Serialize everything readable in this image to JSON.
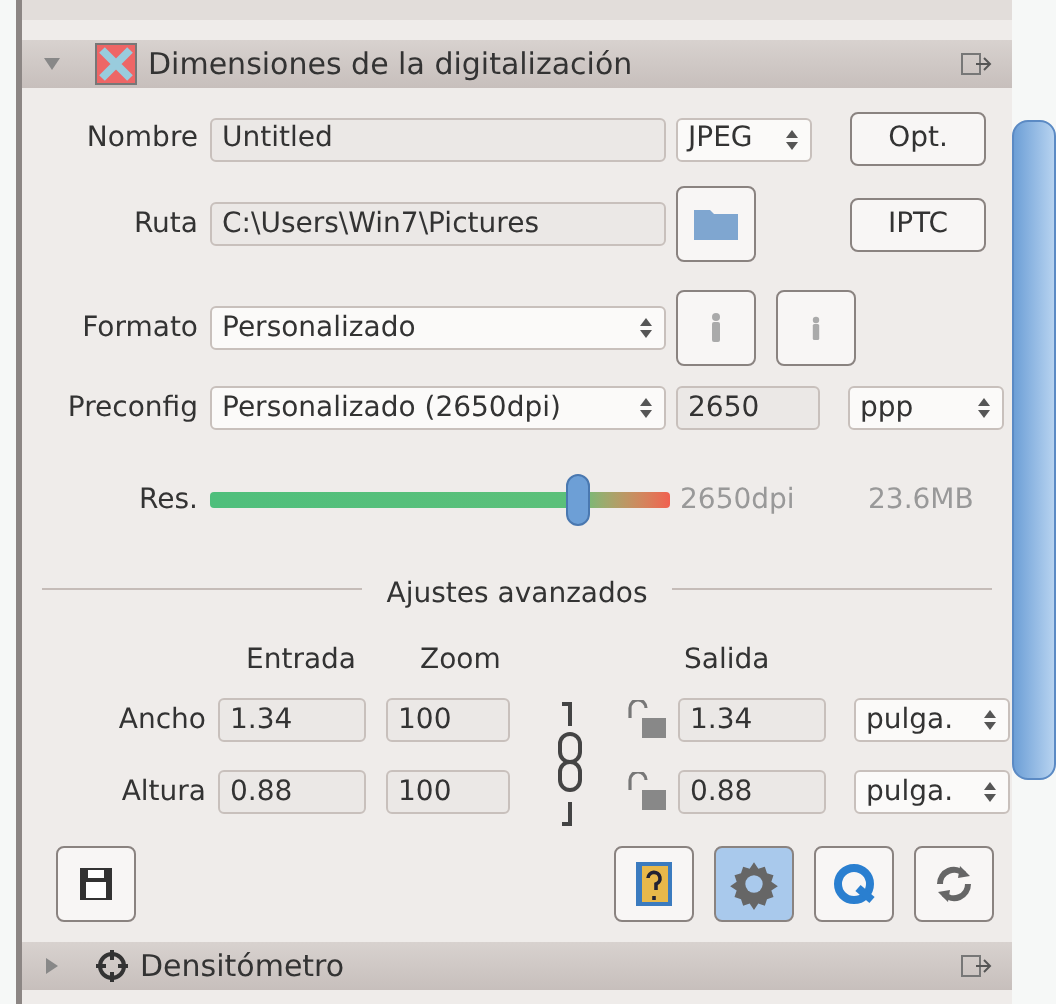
{
  "section": {
    "title": "Dimensiones de la digitalización",
    "expanded": true
  },
  "nombre": {
    "label": "Nombre",
    "value": "Untitled",
    "format": "JPEG",
    "button": "Opt."
  },
  "ruta": {
    "label": "Ruta",
    "value": "C:\\Users\\Win7\\Pictures",
    "button": "IPTC"
  },
  "formato": {
    "label": "Formato",
    "value": "Personalizado"
  },
  "preconfig": {
    "label": "Preconfig",
    "value": "Personalizado (2650dpi)",
    "number": "2650",
    "unit": "ppp"
  },
  "res": {
    "label": "Res.",
    "level": 0.8,
    "reading": "2650dpi",
    "size": "23.6MB"
  },
  "advanced": {
    "title": "Ajustes avanzados",
    "headers": [
      "Entrada",
      "Zoom",
      "Salida"
    ],
    "rows": [
      {
        "label": "Ancho",
        "input": "1.34",
        "zoom": "100",
        "output": "1.34",
        "unit": "pulga."
      },
      {
        "label": "Altura",
        "input": "0.88",
        "zoom": "100",
        "output": "0.88",
        "unit": "pulga."
      }
    ]
  },
  "toolbar": [
    {
      "kind": "help",
      "selected": false
    },
    {
      "kind": "gear",
      "selected": true
    },
    {
      "kind": "preview",
      "selected": false
    },
    {
      "kind": "reset",
      "selected": false
    }
  ],
  "next_section": {
    "title": "Densitómetro",
    "expanded": false
  }
}
